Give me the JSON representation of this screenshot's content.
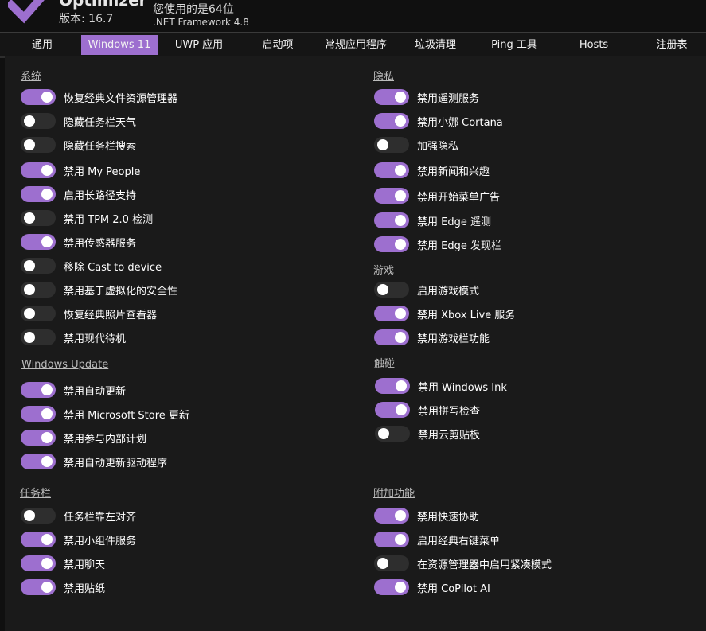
{
  "header": {
    "app_name": "Optimizer",
    "version": "版本: 16.7",
    "arch": "您使用的是64位",
    "framework": ".NET Framework 4.8"
  },
  "tabs": [
    {
      "label": "通用",
      "active": false
    },
    {
      "label": "Windows 11",
      "active": true
    },
    {
      "label": "UWP 应用",
      "active": false
    },
    {
      "label": "启动项",
      "active": false
    },
    {
      "label": "常规应用程序",
      "active": false
    },
    {
      "label": "垃圾清理",
      "active": false
    },
    {
      "label": "Ping 工具",
      "active": false
    },
    {
      "label": "Hosts",
      "active": false
    },
    {
      "label": "注册表",
      "active": false
    }
  ],
  "colors": {
    "accent": "#9d6fcf",
    "off": "#2e2e2e",
    "background": "#1a1a1a"
  },
  "sections": [
    {
      "title": "系统",
      "items": [
        {
          "label": "恢复经典文件资源管理器",
          "on": true
        },
        {
          "label": "隐藏任务栏天气",
          "on": false
        },
        {
          "label": "隐藏任务栏搜索",
          "on": false
        },
        {
          "label": "禁用 My People",
          "on": true
        },
        {
          "label": "启用长路径支持",
          "on": true
        },
        {
          "label": "禁用 TPM 2.0 检测",
          "on": false
        },
        {
          "label": "禁用传感器服务",
          "on": true
        },
        {
          "label": "移除 Cast to device",
          "on": false
        },
        {
          "label": "禁用基于虚拟化的安全性",
          "on": false
        },
        {
          "label": "恢复经典照片查看器",
          "on": false
        },
        {
          "label": "禁用现代待机",
          "on": false
        }
      ]
    },
    {
      "title": "Windows Update",
      "items": [
        {
          "label": "禁用自动更新",
          "on": true
        },
        {
          "label": "禁用 Microsoft Store 更新",
          "on": true
        },
        {
          "label": "禁用参与内部计划",
          "on": true
        },
        {
          "label": "禁用自动更新驱动程序",
          "on": true
        }
      ]
    },
    {
      "title": "任务栏",
      "items": [
        {
          "label": "任务栏靠左对齐",
          "on": false
        },
        {
          "label": "禁用小组件服务",
          "on": true
        },
        {
          "label": "禁用聊天",
          "on": true
        },
        {
          "label": "禁用贴纸",
          "on": true
        }
      ]
    },
    {
      "title": "隐私",
      "items": [
        {
          "label": "禁用遥测服务",
          "on": true
        },
        {
          "label": "禁用小娜 Cortana",
          "on": true
        },
        {
          "label": "加强隐私",
          "on": false
        },
        {
          "label": "禁用新闻和兴趣",
          "on": true
        },
        {
          "label": "禁用开始菜单广告",
          "on": true
        },
        {
          "label": "禁用 Edge 遥测",
          "on": true
        },
        {
          "label": "禁用 Edge 发现栏",
          "on": true
        }
      ]
    },
    {
      "title": "游戏",
      "items": [
        {
          "label": "启用游戏模式",
          "on": false
        },
        {
          "label": "禁用 Xbox Live 服务",
          "on": true
        },
        {
          "label": "禁用游戏栏功能",
          "on": true
        }
      ]
    },
    {
      "title": "触碰",
      "items": [
        {
          "label": "禁用 Windows Ink",
          "on": true
        },
        {
          "label": "禁用拼写检查",
          "on": true
        },
        {
          "label": "禁用云剪贴板",
          "on": false
        }
      ]
    },
    {
      "title": "附加功能",
      "items": [
        {
          "label": "禁用快速协助",
          "on": true
        },
        {
          "label": "启用经典右键菜单",
          "on": true
        },
        {
          "label": "在资源管理器中启用紧凑模式",
          "on": false
        },
        {
          "label": "禁用 CoPilot AI",
          "on": true
        }
      ]
    }
  ]
}
